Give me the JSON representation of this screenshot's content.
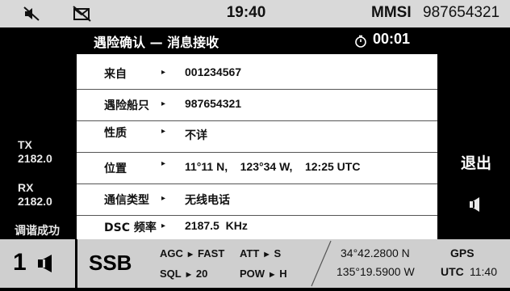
{
  "topbar": {
    "icons": [
      "speaker-muted-icon",
      "message-crossed-icon"
    ],
    "time": "19:40",
    "mmsi_label": "MMSI",
    "mmsi_value": "987654321"
  },
  "dialog": {
    "title": "遇险确认 — 消息接收",
    "timer": "00:01",
    "arrow": "▸",
    "rows": [
      {
        "label": "来自",
        "value": "001234567"
      },
      {
        "label": "遇险船只",
        "value": "987654321"
      },
      {
        "label": "性质",
        "value": "不详"
      },
      {
        "label": "位置",
        "value": "11°11 N,    123°34 W,    12:25 UTC"
      },
      {
        "label": "通信类型",
        "value": "无线电话"
      },
      {
        "label": "DSC 频率",
        "value": "2187.5  KHz"
      }
    ]
  },
  "left": {
    "tx_label": "TX",
    "tx_freq": "2182.0",
    "rx_label": "RX",
    "rx_freq": "2182.0",
    "tune_status": "调谐成功"
  },
  "right": {
    "exit_label": "退出",
    "icon": "speaker-icon"
  },
  "bottom": {
    "channel_number": "1",
    "mode": "SSB",
    "agc_label": "AGC",
    "agc_value": "FAST",
    "att_label": "ATT",
    "att_value": "S",
    "sql_label": "SQL",
    "sql_value": "20",
    "pow_label": "POW",
    "pow_value": "H",
    "lat": "34°42.2800 N",
    "lon": "135°19.5900 W",
    "gps_label": "GPS",
    "utc_label": "UTC",
    "utc_time": "11:40"
  }
}
